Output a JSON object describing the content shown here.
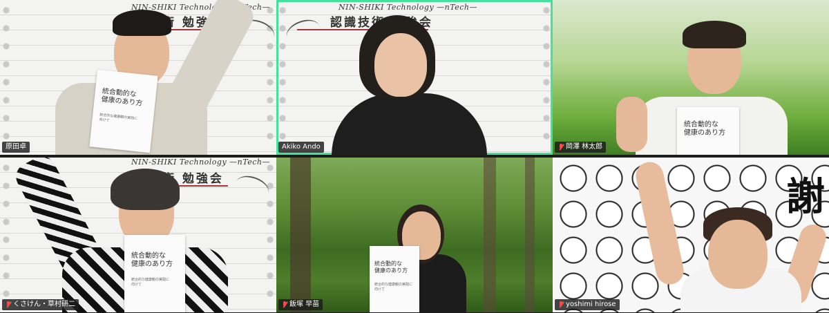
{
  "participants": [
    {
      "name": "原田卓",
      "muted": false,
      "speaking": false
    },
    {
      "name": "Akiko Ando",
      "muted": false,
      "speaking": true
    },
    {
      "name": "岡澤 林太郎",
      "muted": true,
      "speaking": false
    },
    {
      "name": "くさけん・草村研二",
      "muted": true,
      "speaking": false
    },
    {
      "name": "飯塚 早苗",
      "muted": true,
      "speaking": false
    },
    {
      "name": "yoshimi hirose",
      "muted": true,
      "speaking": false
    }
  ],
  "backdrop": {
    "subtitle": "NIN-SHIKI Technology —nTech—",
    "title": "技術 勉強会",
    "title_alt": "認識技術 勉強会"
  },
  "book": {
    "title": "統合動的な\n健康のあり方",
    "subtitle": "統合的な健康観の実践に\n向けて"
  },
  "banner_char": "謝",
  "colors": {
    "speaking_border": "#41e39a",
    "muted_icon": "#ff4b4b"
  }
}
